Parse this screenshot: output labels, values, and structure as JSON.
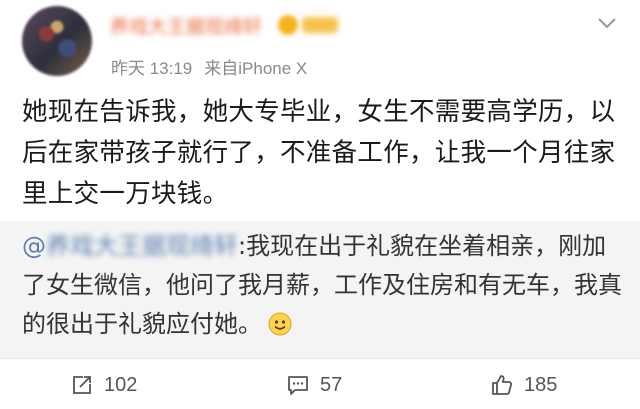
{
  "post": {
    "username": "养戏大王据现绮轩",
    "timestamp": "昨天 13:19",
    "source": "来自iPhone X",
    "text": "她现在告诉我，她大专毕业，女生不需要高学历，以后在家带孩子就行了，不准备工作，让我一个月往家里上交一万块钱。"
  },
  "repost": {
    "at_symbol": "@",
    "mention_name": "养戏大王据现绮轩",
    "text": ":我现在出于礼貌在坐着相亲，刚加了女生微信，他问了我月薪，工作及住房和有无车，我真的很出于礼貌应付她。"
  },
  "actions": {
    "repost_count": "102",
    "comment_count": "57",
    "like_count": "185"
  },
  "icons": {
    "menu": "chevron-down-icon",
    "repost": "repost-icon",
    "comment": "comment-icon",
    "like": "thumbs-up-icon",
    "emoji": "smiley-emoji-icon"
  },
  "colors": {
    "username": "#e86a3c",
    "mention": "#5b7fb0",
    "meta": "#8a8a8a",
    "repost_bg": "#f4f4f4"
  }
}
